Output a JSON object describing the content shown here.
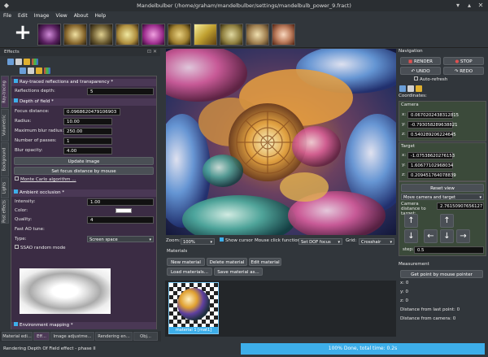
{
  "window": {
    "title": "Mandelbulber (/home/graham/mandelbulber/settings/mandelbulb_power_9.fract)"
  },
  "menu": [
    "File",
    "Edit",
    "Image",
    "View",
    "About",
    "Help"
  ],
  "left_panel": {
    "title": "Effects",
    "vertical_tabs": [
      "Ray-tracing",
      "Volumetric",
      "Background",
      "Lights",
      "Post effects"
    ],
    "raytraced": {
      "header": "Ray-traced reflections and transparency *",
      "reflections_depth_label": "Reflections depth:",
      "reflections_depth": "5"
    },
    "dof": {
      "header": "Depth of field *",
      "focus_label": "Focus distance:",
      "focus": "0.0968620479106903",
      "radius_label": "Radius:",
      "radius": "10.00",
      "maxblur_label": "Maximum blur radius:",
      "maxblur": "250.00",
      "passes_label": "Number of passes:",
      "passes": "1",
      "opacity_label": "Blur opacity:",
      "opacity": "4.00",
      "update_button": "Update image",
      "focus_mouse_button": "Set focus distance by mouse",
      "monte_carlo": "Monte Carlo algorithm ..."
    },
    "ao": {
      "header": "Ambient occlusion *",
      "intensity_label": "Intensity:",
      "intensity": "1.00",
      "color_label": "Color:",
      "quality_label": "Quality:",
      "quality": "4",
      "fast_label": "Fast AO tune:",
      "type_label": "Type:",
      "type": "Screen space",
      "ssao_label": "SSAO random mode"
    },
    "env_header": "Environment mapping *",
    "bottom_tabs": [
      "Material edi...",
      "Eff...",
      "Image adjustme...",
      "Rendering en...",
      "Obj..."
    ]
  },
  "render_bar": {
    "zoom_label": "Zoom:",
    "zoom": "100%",
    "show_cursor": "Show cursor",
    "click_label": "Mouse click function:",
    "click": "Set DOF focus",
    "grid_label": "Grid:",
    "grid": "Crosshair"
  },
  "materials": {
    "title": "Materials",
    "new": "New material",
    "delete": "Delete material",
    "edit": "Edit material",
    "load": "Load materials...",
    "save": "Save material as...",
    "item": "material 1 [mat1]"
  },
  "navigation": {
    "title": "Navigation",
    "render": "RENDER",
    "stop": "STOP",
    "undo": "UNDO",
    "redo": "REDO",
    "auto_refresh": "Auto-refresh",
    "coords_label": "Coordinates:",
    "camera_label": "Camera",
    "camera": {
      "x": "0.0670202438312815",
      "y": "-0.793058289638821",
      "z": "0.540289206224645"
    },
    "target_label": "Target",
    "target": {
      "x": "-1.07538620276153",
      "y": "1.60677102968034",
      "z": "0.209451764078839"
    },
    "reset_view": "Reset view",
    "move_mode": "Move camera and target",
    "cam_dist_label": "Camera distance to target:",
    "cam_dist": "2.76150907656127",
    "step_label": "step:",
    "step": "0.5"
  },
  "measurement": {
    "title": "Measurement",
    "button": "Get point by mouse pointer",
    "x": "x: 0",
    "y": "y: 0",
    "z": "z: 0",
    "from_last": "Distance from last point: 0",
    "from_camera": "Distance from camera: 0"
  },
  "status": {
    "message": "Rendering Depth Of Field effect - phase II",
    "progress": "100% Done, total time: 0.2s",
    "progress_value": 1.0
  },
  "colors": {
    "accent": "#3daee9",
    "section": "#4a3855",
    "panel": "#3b2c44",
    "bg": "#31363b"
  },
  "icons": [
    "plus-icon",
    "fractal-thumbnail-1",
    "fractal-thumbnail-2",
    "fractal-thumbnail-3",
    "fractal-thumbnail-4",
    "fractal-thumbnail-5",
    "fractal-thumbnail-6",
    "fractal-thumbnail-7",
    "fractal-thumbnail-8",
    "fractal-thumbnail-9",
    "fractal-thumbnail-10",
    "arrow-up-icon",
    "arrow-down-icon",
    "arrow-left-icon",
    "arrow-right-icon"
  ]
}
